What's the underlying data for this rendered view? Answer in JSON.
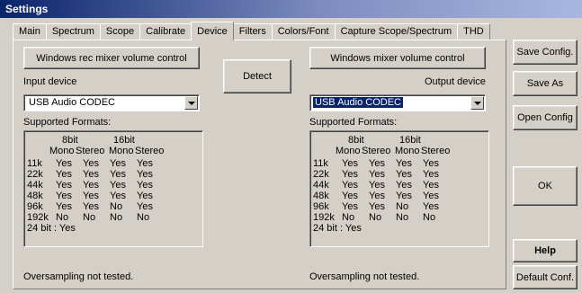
{
  "window": {
    "title": "Settings"
  },
  "tabs": [
    "Main",
    "Spectrum",
    "Scope",
    "Calibrate",
    "Device",
    "Filters",
    "Colors/Font",
    "Capture Scope/Spectrum",
    "THD"
  ],
  "active_tab": "Device",
  "input": {
    "mixer_button": "Windows rec mixer volume control",
    "device_label": "Input device",
    "device_value": "USB Audio CODEC",
    "formats_label": "Supported Formats:",
    "oversampling": "Oversampling not tested."
  },
  "output": {
    "mixer_button": "Windows mixer volume control",
    "device_label": "Output device",
    "device_value": "USB Audio CODEC",
    "formats_label": "Supported Formats:",
    "oversampling": "Oversampling not tested."
  },
  "detect_button": "Detect",
  "formats": {
    "bit_headers": [
      "8bit",
      "16bit"
    ],
    "channel_headers": [
      "Mono",
      "Stereo",
      "Mono",
      "Stereo"
    ],
    "rows": [
      {
        "rate": "11k",
        "values": [
          "Yes",
          "Yes",
          "Yes",
          "Yes"
        ]
      },
      {
        "rate": "22k",
        "values": [
          "Yes",
          "Yes",
          "Yes",
          "Yes"
        ]
      },
      {
        "rate": "44k",
        "values": [
          "Yes",
          "Yes",
          "Yes",
          "Yes"
        ]
      },
      {
        "rate": "48k",
        "values": [
          "Yes",
          "Yes",
          "Yes",
          "Yes"
        ]
      },
      {
        "rate": "96k",
        "values": [
          "Yes",
          "Yes",
          "No",
          "Yes"
        ]
      },
      {
        "rate": "192k",
        "values": [
          "No",
          "No",
          "No",
          "No"
        ]
      }
    ],
    "extra": "24 bit : Yes"
  },
  "side_buttons": {
    "save_config": "Save Config.",
    "save_as": "Save As",
    "open_config": "Open Config",
    "ok": "OK",
    "help": "Help",
    "default_conf": "Default Conf."
  }
}
